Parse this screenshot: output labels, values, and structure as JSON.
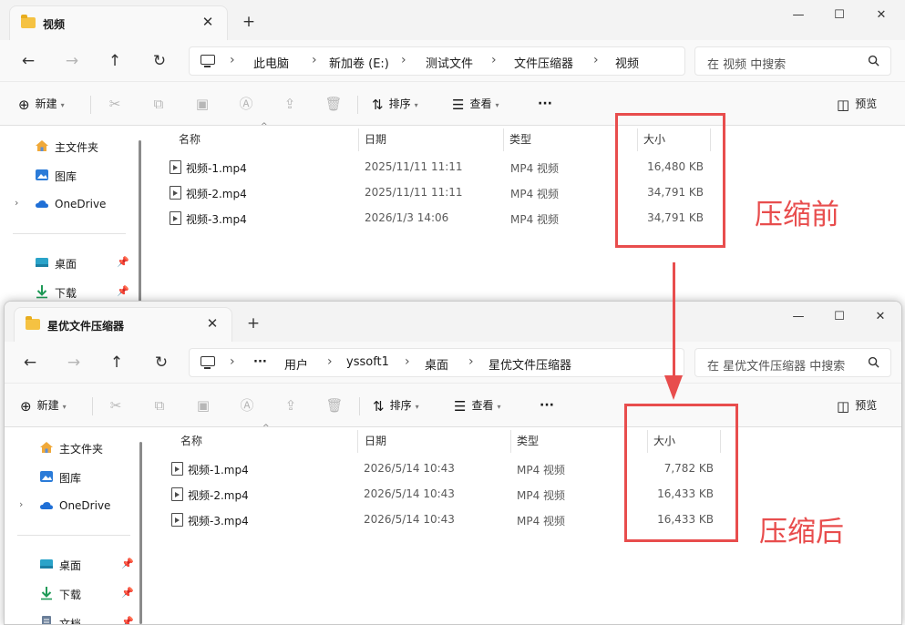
{
  "before_window": {
    "tab_title": "视频",
    "new_tab": "+",
    "controls": {
      "minimize": "—",
      "maximize": "☐",
      "close": "✕"
    },
    "breadcrumb": [
      "此电脑",
      "新加卷 (E:)",
      "测试文件",
      "文件压缩器",
      "视频"
    ],
    "search_placeholder": "在 视频 中搜索",
    "toolbar": {
      "new": "新建",
      "sort": "排序",
      "view": "查看",
      "more": "···",
      "preview": "预览"
    },
    "sidebar": {
      "items": [
        {
          "label": "主文件夹",
          "icon": "home-icon"
        },
        {
          "label": "图库",
          "icon": "gallery-icon"
        },
        {
          "label": "OneDrive",
          "icon": "cloud-icon"
        },
        {
          "label": "桌面",
          "icon": "desktop-icon"
        },
        {
          "label": "下载",
          "icon": "download-icon"
        }
      ]
    },
    "columns": {
      "name": "名称",
      "date": "日期",
      "type": "类型",
      "size": "大小"
    },
    "files": [
      {
        "name": "视频-1.mp4",
        "date": "2025/11/11 11:11",
        "type": "MP4 视频",
        "size": "16,480 KB"
      },
      {
        "name": "视频-2.mp4",
        "date": "2025/11/11 11:11",
        "type": "MP4 视频",
        "size": "34,791 KB"
      },
      {
        "name": "视频-3.mp4",
        "date": "2026/1/3 14:06",
        "type": "MP4 视频",
        "size": "34,791 KB"
      }
    ]
  },
  "after_window": {
    "tab_title": "星优文件压缩器",
    "new_tab": "+",
    "controls": {
      "minimize": "—",
      "maximize": "☐",
      "close": "✕"
    },
    "breadcrumb": [
      "···",
      "用户",
      "yssoft1",
      "桌面",
      "星优文件压缩器"
    ],
    "search_placeholder": "在 星优文件压缩器 中搜索",
    "toolbar": {
      "new": "新建",
      "sort": "排序",
      "view": "查看",
      "more": "···",
      "preview": "预览"
    },
    "sidebar": {
      "items": [
        {
          "label": "主文件夹",
          "icon": "home-icon"
        },
        {
          "label": "图库",
          "icon": "gallery-icon"
        },
        {
          "label": "OneDrive",
          "icon": "cloud-icon"
        },
        {
          "label": "桌面",
          "icon": "desktop-icon"
        },
        {
          "label": "下载",
          "icon": "download-icon"
        },
        {
          "label": "文档",
          "icon": "document-icon"
        }
      ]
    },
    "columns": {
      "name": "名称",
      "date": "日期",
      "type": "类型",
      "size": "大小"
    },
    "files": [
      {
        "name": "视频-1.mp4",
        "date": "2026/5/14 10:43",
        "type": "MP4 视频",
        "size": "7,782 KB"
      },
      {
        "name": "视频-2.mp4",
        "date": "2026/5/14 10:43",
        "type": "MP4 视频",
        "size": "16,433 KB"
      },
      {
        "name": "视频-3.mp4",
        "date": "2026/5/14 10:43",
        "type": "MP4 视频",
        "size": "16,433 KB"
      }
    ]
  },
  "annotations": {
    "before_label": "压缩前",
    "after_label": "压缩后",
    "color": "#e84d4d"
  }
}
